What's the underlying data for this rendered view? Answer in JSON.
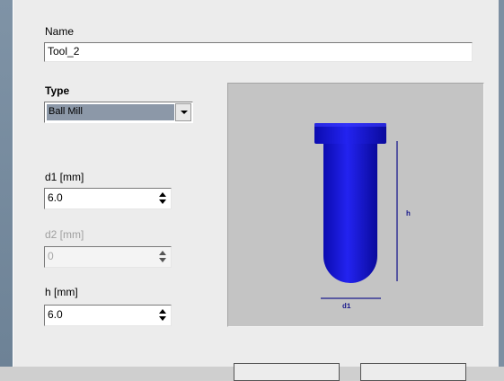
{
  "form": {
    "name_label": "Name",
    "name_value": "Tool_2",
    "type_label": "Type",
    "type_value": "Ball Mill",
    "d1_label": "d1 [mm]",
    "d1_value": "6.0",
    "d2_label": "d2 [mm]",
    "d2_value": "0",
    "h_label": "h [mm]",
    "h_value": "6.0"
  },
  "preview": {
    "h_label": "h",
    "d1_label": "d1",
    "tool_color": "#1414e0"
  }
}
